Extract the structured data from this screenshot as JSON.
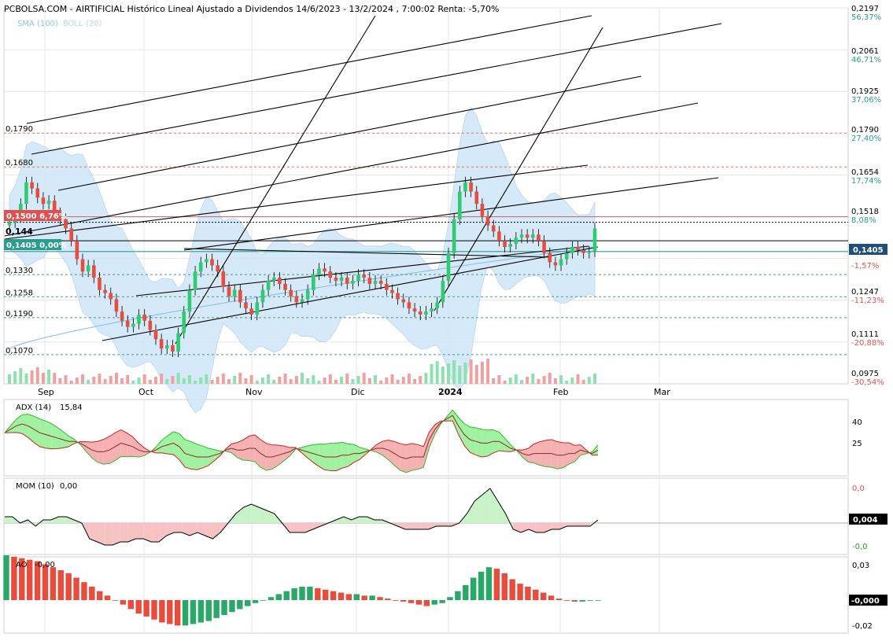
{
  "header": {
    "title": "PCBOLSA.COM - AIRTIFICIAL Histórico Lineal Ajustado a Dividendos 14/6/2023 - 13/2/2024 , 7:00:02 Renta: -5,70%",
    "legend_sma": "SMA (100)",
    "legend_boll": "BOLL (20)"
  },
  "colors": {
    "up": "#2ecc71",
    "down": "#e74c3c",
    "boll_fill": "#cfe6f7",
    "sma": "#8ec3e8",
    "grid": "#e6e6e6",
    "dashed_red": "#e07070",
    "dashed_teal": "#4a9a8a",
    "badge_red": "#e05050",
    "badge_teal": "#2a9d8f",
    "badge_navy": "#1f4e79"
  },
  "price_axis": {
    "levels": [
      {
        "value": "0,2197",
        "pct": "56,37%",
        "pct_color": "#2a9d8f"
      },
      {
        "value": "0,2061",
        "pct": "46,71%",
        "pct_color": "#2a9d8f"
      },
      {
        "value": "0,1925",
        "pct": "37,06%",
        "pct_color": "#2a9d8f"
      },
      {
        "value": "0,1790",
        "pct": "27,40%",
        "pct_color": "#2a9d8f"
      },
      {
        "value": "0,1654",
        "pct": "17,74%",
        "pct_color": "#2a9d8f"
      },
      {
        "value": "0,1518",
        "pct": "8,08%",
        "pct_color": "#2a9d8f"
      },
      {
        "value": "",
        "pct": "-1,57%",
        "pct_color": "#e05050"
      },
      {
        "value": "0,1247",
        "pct": "-11,23%",
        "pct_color": "#e05050"
      },
      {
        "value": "0,1111",
        "pct": "-20,88%",
        "pct_color": "#e05050"
      },
      {
        "value": "0,0975",
        "pct": "-30,54%",
        "pct_color": "#e05050"
      }
    ],
    "current_badge": "0,1405"
  },
  "left_labels": [
    {
      "text": "0,1790",
      "value": 0.179
    },
    {
      "text": "0,1680",
      "value": 0.168
    },
    {
      "text": "0,1330",
      "value": 0.133
    },
    {
      "text": "0,1258",
      "value": 0.1258
    },
    {
      "text": "0,1190",
      "value": 0.119
    },
    {
      "text": "0,1070",
      "value": 0.107
    }
  ],
  "left_badges": {
    "red": "0,1500  6,76%",
    "teal": "0,1405  0,00%",
    "bold": "0,144"
  },
  "months": [
    "Sep",
    "Oct",
    "Nov",
    "Dic",
    "2024",
    "Feb",
    "Mar"
  ],
  "adx": {
    "label": "ADX (14)",
    "value": "15,84",
    "ticks": [
      "40",
      "25"
    ]
  },
  "mom": {
    "label": "MOM (10)",
    "value": "0,00",
    "ticks": [
      "0,0",
      "-0,0"
    ],
    "badge": "0,004"
  },
  "ao": {
    "label": "AO",
    "value": "-0,00",
    "ticks": [
      "0,03",
      "-0,02"
    ],
    "badge": "-0,000"
  },
  "chart_data": {
    "type": "candlestick",
    "title": "PCBOLSA.COM - AIRTIFICIAL Histórico Lineal Ajustado a Dividendos 14/6/2023 - 13/2/2024",
    "ylim": [
      0.0975,
      0.2197
    ],
    "last_price": 0.1405,
    "reference_lines": [
      0.179,
      0.168,
      0.1518,
      0.15,
      0.144,
      0.1405,
      0.133,
      0.1258,
      0.119,
      0.107
    ],
    "close_series": [
      0.15,
      0.152,
      0.156,
      0.163,
      0.161,
      0.158,
      0.156,
      0.157,
      0.153,
      0.151,
      0.148,
      0.144,
      0.138,
      0.134,
      0.136,
      0.132,
      0.128,
      0.127,
      0.125,
      0.121,
      0.118,
      0.116,
      0.117,
      0.12,
      0.118,
      0.115,
      0.112,
      0.109,
      0.11,
      0.108,
      0.114,
      0.121,
      0.128,
      0.134,
      0.137,
      0.138,
      0.136,
      0.134,
      0.129,
      0.126,
      0.128,
      0.124,
      0.122,
      0.12,
      0.124,
      0.128,
      0.131,
      0.132,
      0.13,
      0.128,
      0.126,
      0.124,
      0.125,
      0.128,
      0.133,
      0.135,
      0.134,
      0.132,
      0.131,
      0.132,
      0.13,
      0.131,
      0.133,
      0.132,
      0.13,
      0.131,
      0.13,
      0.128,
      0.127,
      0.125,
      0.124,
      0.122,
      0.121,
      0.12,
      0.121,
      0.122,
      0.124,
      0.131,
      0.14,
      0.151,
      0.16,
      0.163,
      0.16,
      0.156,
      0.152,
      0.149,
      0.147,
      0.144,
      0.142,
      0.143,
      0.145,
      0.146,
      0.145,
      0.146,
      0.144,
      0.14,
      0.137,
      0.136,
      0.138,
      0.14,
      0.142,
      0.141,
      0.14,
      0.1405,
      0.148
    ],
    "adx_series": [
      34,
      36,
      38,
      39,
      38,
      36,
      34,
      33,
      32,
      31,
      30,
      29,
      29,
      28,
      26,
      24,
      23,
      23,
      24,
      26,
      28,
      27,
      26,
      24,
      23,
      23,
      24,
      26,
      27,
      28,
      26,
      22,
      21,
      20,
      20,
      20,
      21,
      22,
      24,
      25,
      24,
      24,
      25,
      25,
      22,
      20,
      20,
      21,
      22,
      23,
      25,
      24,
      23,
      22,
      21,
      20,
      20,
      20,
      21,
      21,
      22,
      22,
      23,
      24,
      25,
      25,
      24,
      22,
      20,
      19,
      20,
      20,
      20,
      30,
      36,
      40,
      42,
      44,
      38,
      33,
      30,
      29,
      28,
      28,
      29,
      29,
      27,
      25,
      24,
      22,
      21,
      22,
      22,
      22,
      22,
      21,
      21,
      22,
      22,
      24,
      23,
      22,
      24
    ],
    "mom_series": [
      0.002,
      0.002,
      0.0,
      0.001,
      -0.001,
      0.001,
      0.001,
      0.002,
      0.002,
      0.001,
      0.0,
      -0.005,
      -0.006,
      -0.007,
      -0.007,
      -0.006,
      -0.006,
      -0.005,
      -0.005,
      -0.006,
      -0.006,
      -0.004,
      -0.003,
      -0.003,
      -0.004,
      -0.003,
      -0.004,
      -0.005,
      -0.003,
      0.0,
      0.003,
      0.005,
      0.006,
      0.005,
      0.004,
      0.003,
      0.0,
      -0.003,
      -0.003,
      -0.003,
      -0.002,
      -0.001,
      0.0,
      0.001,
      0.002,
      0.001,
      0.002,
      0.002,
      0.001,
      0.001,
      0.0,
      -0.001,
      -0.002,
      -0.002,
      -0.002,
      -0.002,
      -0.001,
      -0.001,
      -0.001,
      0.0,
      0.003,
      0.007,
      0.009,
      0.011,
      0.007,
      0.003,
      -0.002,
      -0.003,
      -0.002,
      -0.003,
      -0.003,
      -0.002,
      -0.002,
      -0.001,
      -0.001,
      -0.001,
      -0.001,
      0.001
    ],
    "ao_series": [
      0.03,
      0.029,
      0.028,
      0.027,
      0.026,
      0.024,
      0.022,
      0.02,
      0.018,
      0.015,
      0.012,
      0.009,
      0.006,
      0.003,
      0.0,
      -0.003,
      -0.006,
      -0.009,
      -0.011,
      -0.013,
      -0.015,
      -0.016,
      -0.017,
      -0.017,
      -0.016,
      -0.015,
      -0.014,
      -0.012,
      -0.01,
      -0.008,
      -0.006,
      -0.004,
      -0.002,
      0.0,
      0.002,
      0.004,
      0.006,
      0.008,
      0.009,
      0.009,
      0.008,
      0.007,
      0.006,
      0.005,
      0.004,
      0.004,
      0.003,
      0.003,
      0.002,
      0.001,
      0.0,
      -0.001,
      -0.002,
      -0.003,
      -0.004,
      -0.003,
      -0.002,
      0.002,
      0.006,
      0.01,
      0.015,
      0.019,
      0.022,
      0.021,
      0.018,
      0.014,
      0.011,
      0.009,
      0.007,
      0.005,
      0.003,
      0.001,
      0.0,
      -0.001,
      -0.001,
      -0.0,
      -0.0
    ]
  }
}
